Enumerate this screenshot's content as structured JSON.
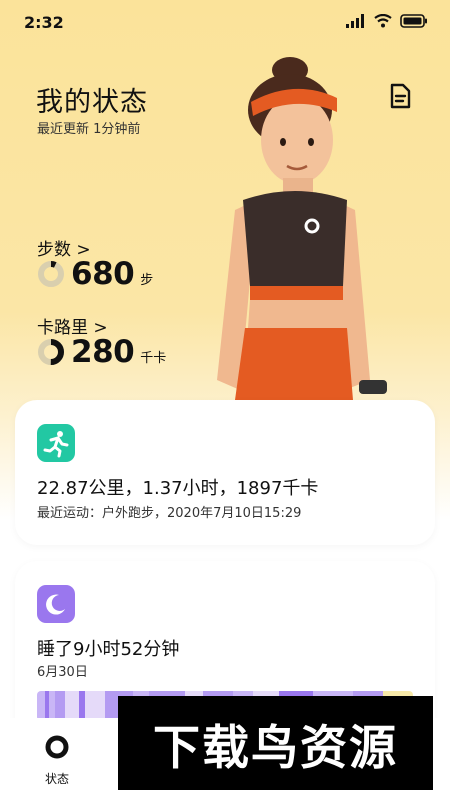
{
  "status_bar": {
    "time": "2:32"
  },
  "header": {
    "title": "我的状态",
    "subtitle": "最近更新 1分钟前"
  },
  "metrics": {
    "steps": {
      "label": "步数 >",
      "value": "680",
      "unit": "步",
      "progress": 0.07
    },
    "calories": {
      "label": "卡路里 >",
      "value": "280",
      "unit": "千卡",
      "progress": 0.5
    }
  },
  "run_card": {
    "summary": "22.87公里，1.37小时，1897千卡",
    "detail": "最近运动：户外跑步，2020年7月10日15:29",
    "icon": "running-icon",
    "accent": "#22c8a3"
  },
  "sleep_card": {
    "summary": "睡了9小时52分钟",
    "date": "6月30日",
    "icon": "moon-icon",
    "accent": "#9a77ee"
  },
  "nav": {
    "items": [
      {
        "label": "状态",
        "icon": "status-ring-icon"
      }
    ]
  },
  "watermark": {
    "text": "下载鸟资源"
  }
}
